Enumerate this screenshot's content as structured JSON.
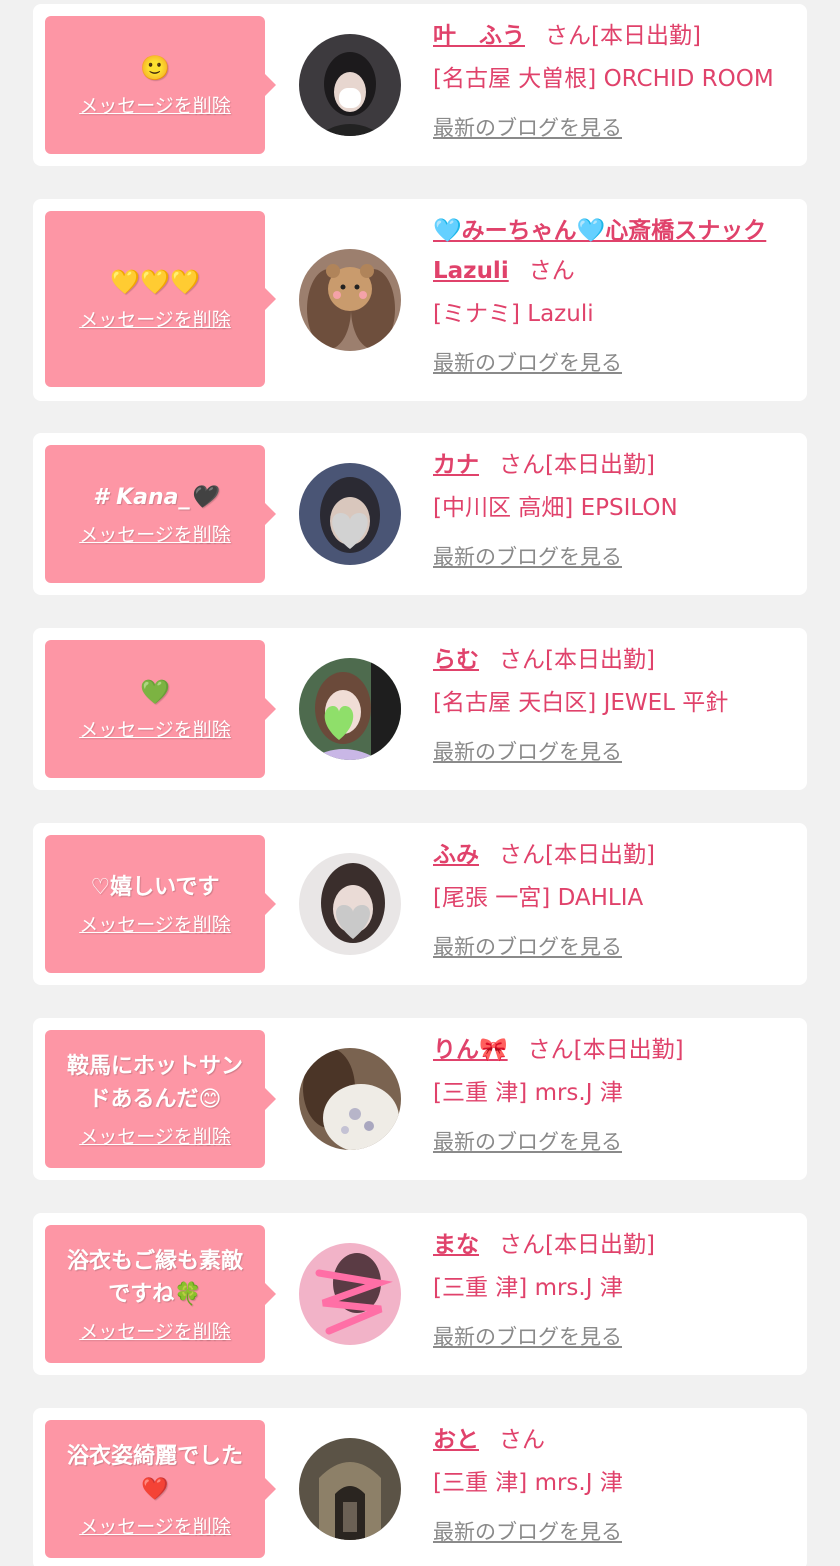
{
  "colors": {
    "page_bg": "#f1f1f1",
    "card_bg": "#ffffff",
    "bubble_bg": "#fd96a5",
    "accent": "#e0426b",
    "link_gray": "#8a8a8a"
  },
  "delete_label": "メッセージを削除",
  "blog_label": "最新のブログを見る",
  "entries": [
    {
      "message": "🙂",
      "message_kind": "emoji",
      "name": "叶　ふう",
      "suffix": "さん[本日出勤]",
      "shop": "[名古屋 大曽根] ORCHID ROOM",
      "avatar_icon": "woman-portrait-photo",
      "avatar_color": "#3d3a3e"
    },
    {
      "message": "💛💛💛",
      "message_kind": "emoji",
      "name": "🩵みーちゃん🩵心斎橋スナックLazuli",
      "suffix": "さん",
      "shop": "[ミナミ] Lazuli",
      "avatar_icon": "bear-sticker-portrait-photo",
      "avatar_color": "#9c7f6e"
    },
    {
      "message": "# Kana_🖤",
      "message_kind": "text",
      "name": "カナ",
      "suffix": "さん[本日出勤]",
      "shop": "[中川区 高畑] EPSILON",
      "avatar_icon": "blurred-face-photo",
      "avatar_color": "#4a5575"
    },
    {
      "message": "💚",
      "message_kind": "emoji",
      "name": "らむ",
      "suffix": "さん[本日出勤]",
      "shop": "[名古屋 天白区] JEWEL 平針",
      "avatar_icon": "woman-with-heart-sticker-photo",
      "avatar_color": "#4e6b4e"
    },
    {
      "message": "♡嬉しいです",
      "message_kind": "text",
      "name": "ふみ",
      "suffix": "さん[本日出勤]",
      "shop": "[尾張 一宮] DAHLIA",
      "avatar_icon": "blurred-face-photo",
      "avatar_color": "#6a5a55"
    },
    {
      "message": "鞍馬にホットサンドあるんだ😊",
      "message_kind": "text",
      "name": "りん🎀",
      "suffix": "さん[本日出勤]",
      "shop": "[三重 津] mrs.J 津",
      "avatar_icon": "flower-dress-photo",
      "avatar_color": "#7a6350"
    },
    {
      "message": "浴衣もご縁も素敵ですね🍀",
      "message_kind": "text",
      "name": "まな",
      "suffix": "さん[本日出勤]",
      "shop": "[三重 津] mrs.J 津",
      "avatar_icon": "pink-scribble-photo",
      "avatar_color": "#f2b3c8"
    },
    {
      "message": "浴衣姿綺麗でした❤️",
      "message_kind": "text",
      "name": "おと",
      "suffix": "さん",
      "shop": "[三重 津] mrs.J 津",
      "avatar_icon": "doorway-photo",
      "avatar_color": "#5b5346"
    }
  ]
}
